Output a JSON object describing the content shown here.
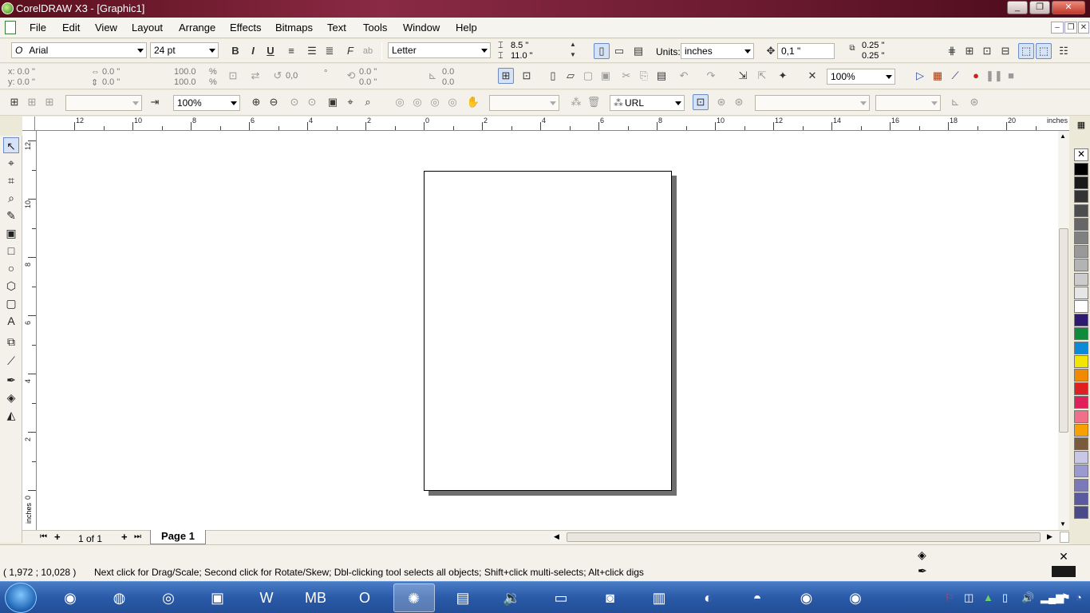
{
  "window": {
    "title": "CorelDRAW X3 - [Graphic1]",
    "minimize": "_",
    "maximize": "❐",
    "close": "✕",
    "mdi_min": "–",
    "mdi_restore": "❐",
    "mdi_close": "✕"
  },
  "menu": [
    "File",
    "Edit",
    "View",
    "Layout",
    "Arrange",
    "Effects",
    "Bitmaps",
    "Text",
    "Tools",
    "Window",
    "Help"
  ],
  "property_bar": {
    "font_name": "Arial",
    "font_size": "24 pt",
    "paper_size": "Letter",
    "page_width": "8.5 \"",
    "page_height": "11.0 \"",
    "units_label": "Units:",
    "units_value": "inches",
    "nudge": "0,1 \"",
    "dup_x": "0.25 \"",
    "dup_y": "0.25 \"",
    "zoom_level": "100%"
  },
  "transform_bar": {
    "x": "x: 0.0 \"",
    "y": "y: 0.0 \"",
    "w": "0.0 \"",
    "h": "0.0 \"",
    "scale_w": "100.0",
    "scale_h": "100.0",
    "pct": "%",
    "angle": "0,0",
    "deg": "°",
    "cx": "0.0 \"",
    "cy": "0.0 \"",
    "skew1": "0.0",
    "skew2": "0.0"
  },
  "std_bar": {
    "zoom_level": "100%",
    "url_label": "URL"
  },
  "rulers": {
    "unit": "inches",
    "h_labels": [
      "12",
      "10",
      "8",
      "6",
      "4",
      "2",
      "0",
      "2",
      "4",
      "6",
      "8",
      "10",
      "12",
      "14",
      "16",
      "18",
      "20"
    ],
    "v_labels": [
      "12",
      "10",
      "8",
      "6",
      "4",
      "2",
      "0"
    ]
  },
  "page_nav": {
    "first": "⏮",
    "add_before": "+",
    "count": "1 of 1",
    "add_after": "+",
    "last": "⏭",
    "tab": "Page 1"
  },
  "status": {
    "coords": "( 1,972 ; 10,028 )",
    "message": "Next click for Drag/Scale; Second click for Rotate/Skew; Dbl-clicking tool selects all objects; Shift+click multi-selects; Alt+click digs"
  },
  "palette_colors": [
    "#000000",
    "#1a1a1a",
    "#333333",
    "#4d4d4d",
    "#666666",
    "#808080",
    "#999999",
    "#b3b3b3",
    "#cccccc",
    "#e6e6e6",
    "#ffffff",
    "#2e1a6e",
    "#108a3c",
    "#0a8ad8",
    "#f2e600",
    "#f28a00",
    "#e02020",
    "#e0205a",
    "#f0708a",
    "#f8a000",
    "#7a5a3c",
    "#c8c8e6",
    "#9a9ad0",
    "#7a7ab8",
    "#5a5aa0",
    "#4a4a8a"
  ],
  "taskbar_apps": [
    {
      "name": "chrome",
      "glyph": "◉",
      "active": false
    },
    {
      "name": "firefox",
      "glyph": "◍",
      "active": false
    },
    {
      "name": "speaker",
      "glyph": "◎",
      "active": false
    },
    {
      "name": "powerpoint",
      "glyph": "▣",
      "active": false
    },
    {
      "name": "word",
      "glyph": "W",
      "active": false
    },
    {
      "name": "malwarebytes",
      "glyph": "MB",
      "active": false
    },
    {
      "name": "opera",
      "glyph": "O",
      "active": false
    },
    {
      "name": "coreldraw",
      "glyph": "✺",
      "active": true
    },
    {
      "name": "book",
      "glyph": "▤",
      "active": false
    },
    {
      "name": "volume",
      "glyph": "🔉",
      "active": false
    },
    {
      "name": "monitor",
      "glyph": "▭",
      "active": false
    },
    {
      "name": "zoom",
      "glyph": "◙",
      "active": false
    },
    {
      "name": "explorer",
      "glyph": "▥",
      "active": false
    },
    {
      "name": "media",
      "glyph": "◐",
      "active": false
    },
    {
      "name": "edge",
      "glyph": "◓",
      "active": false
    },
    {
      "name": "chrome-user",
      "glyph": "◉",
      "active": false
    },
    {
      "name": "chrome2",
      "glyph": "◉",
      "active": false
    }
  ]
}
